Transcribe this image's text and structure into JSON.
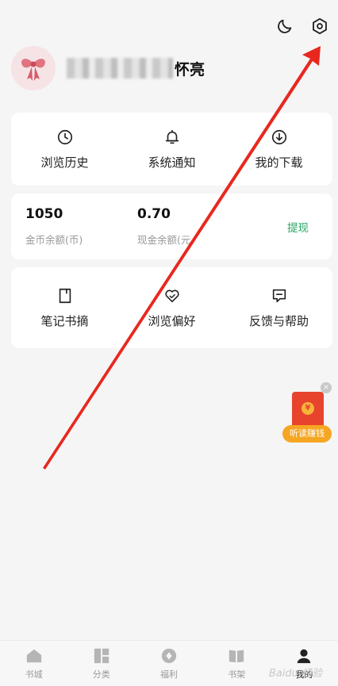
{
  "header": {
    "icons": [
      "moon-icon",
      "settings-icon"
    ]
  },
  "profile": {
    "username_visible_suffix": "怀亮"
  },
  "quick_actions": [
    {
      "label": "浏览历史",
      "icon": "clock-icon"
    },
    {
      "label": "系统通知",
      "icon": "bell-icon"
    },
    {
      "label": "我的下载",
      "icon": "download-icon"
    }
  ],
  "wallet": {
    "coins": "1050",
    "coins_label": "金币余额(币)",
    "cash": "0.70",
    "cash_label": "现金余额(元",
    "withdraw_label": "提现",
    "accent": "#25a55f"
  },
  "tools": [
    {
      "label": "笔记书摘",
      "icon": "note-icon"
    },
    {
      "label": "浏览偏好",
      "icon": "heart-icon"
    },
    {
      "label": "反馈与帮助",
      "icon": "feedback-icon"
    }
  ],
  "float_ad": {
    "label": "听读赚钱",
    "coin_text": "¥"
  },
  "tabbar": [
    {
      "label": "书城",
      "icon": "home-icon",
      "active": false
    },
    {
      "label": "分类",
      "icon": "category-icon",
      "active": false
    },
    {
      "label": "福利",
      "icon": "welfare-icon",
      "active": false
    },
    {
      "label": "书架",
      "icon": "bookshelf-icon",
      "active": false
    },
    {
      "label": "我的",
      "icon": "profile-icon",
      "active": true
    }
  ],
  "watermark": "Baidu 经验",
  "annotation_color": "#e8281e"
}
